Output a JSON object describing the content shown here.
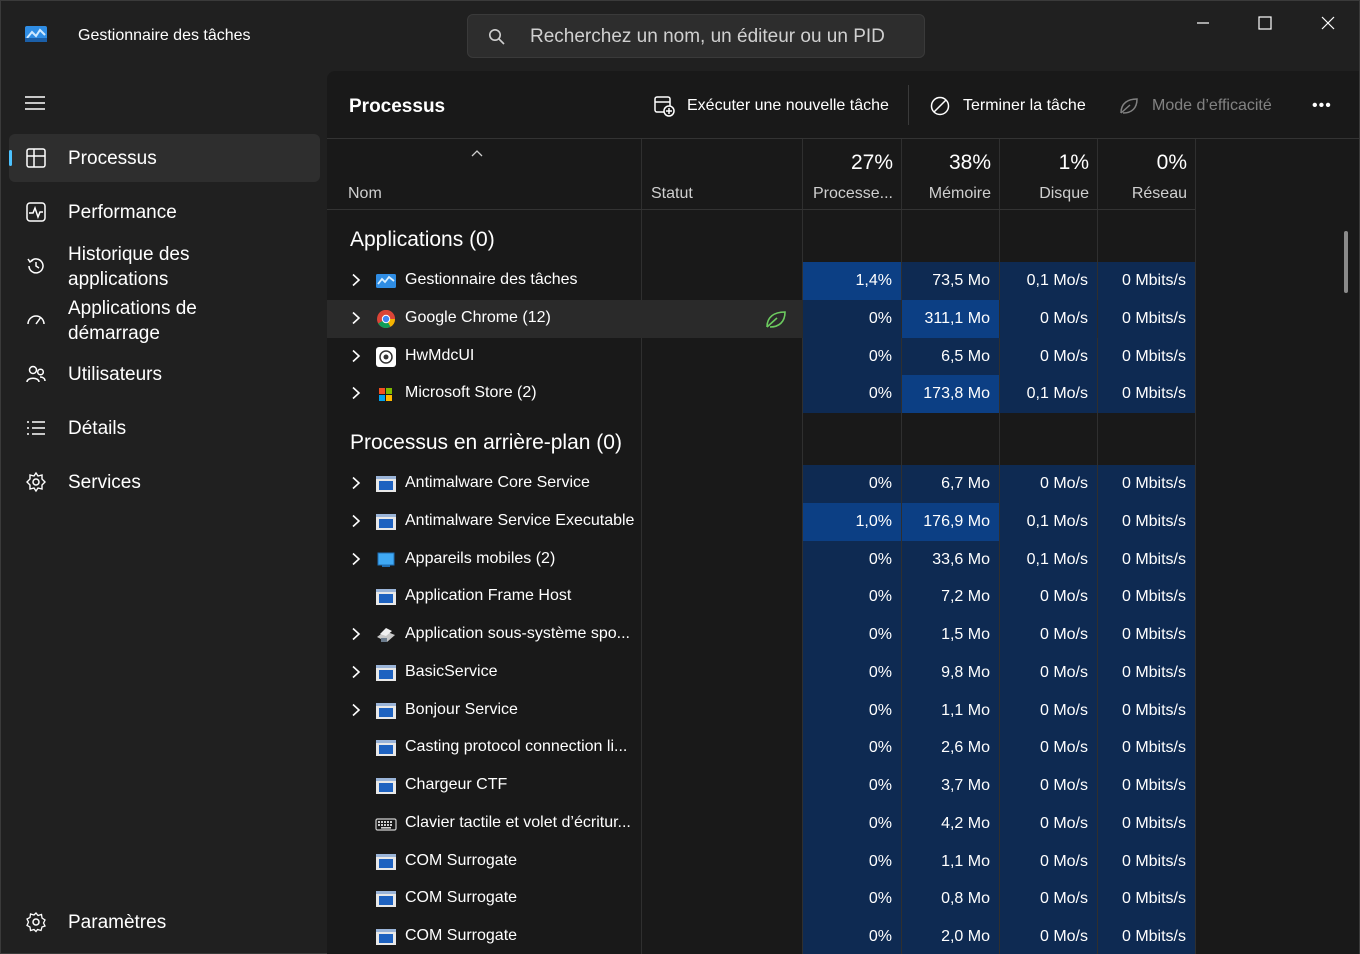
{
  "window": {
    "title": "Gestionnaire des tâches"
  },
  "search": {
    "placeholder": "Recherchez un nom, un éditeur ou un PID"
  },
  "colors": {
    "accent": "#4cc2ff",
    "heat_low": "#0e2a52",
    "heat_high": "#0c3f84",
    "efficiency_leaf": "#6ccb5f"
  },
  "sidebar": {
    "items": [
      {
        "label": "Processus",
        "icon": "processes-icon",
        "active": true
      },
      {
        "label": "Performance",
        "icon": "performance-icon"
      },
      {
        "label": "Historique des\napplications",
        "icon": "history-icon"
      },
      {
        "label": "Applications de\ndémarrage",
        "icon": "startup-icon"
      },
      {
        "label": "Utilisateurs",
        "icon": "users-icon"
      },
      {
        "label": "Détails",
        "icon": "details-icon"
      },
      {
        "label": "Services",
        "icon": "services-icon"
      }
    ],
    "settings_label": "Paramètres"
  },
  "toolbar": {
    "title": "Processus",
    "run_task_label": "Exécuter une nouvelle tâche",
    "end_task_label": "Terminer la tâche",
    "efficiency_label": "Mode d’efficacité",
    "more_label": "•••"
  },
  "columns": {
    "name": "Nom",
    "status": "Statut",
    "cpu": {
      "pct": "27%",
      "label": "Processe..."
    },
    "memory": {
      "pct": "38%",
      "label": "Mémoire"
    },
    "disk": {
      "pct": "1%",
      "label": "Disque"
    },
    "network": {
      "pct": "0%",
      "label": "Réseau"
    }
  },
  "sections": {
    "apps_title": "Applications (0)",
    "bg_title": "Processus en arrière-plan (0)"
  },
  "apps": [
    {
      "name": "Gestionnaire des tâches",
      "cpu": "1,4%",
      "mem": "73,5 Mo",
      "disk": "0,1 Mo/s",
      "net": "0 Mbits/s",
      "expandable": true,
      "icon": "taskmgr-icon"
    },
    {
      "name": "Google Chrome (12)",
      "cpu": "0%",
      "mem": "311,1 Mo",
      "disk": "0 Mo/s",
      "net": "0 Mbits/s",
      "expandable": true,
      "icon": "chrome-icon",
      "efficiency": true
    },
    {
      "name": "HwMdcUI",
      "cpu": "0%",
      "mem": "6,5 Mo",
      "disk": "0 Mo/s",
      "net": "0 Mbits/s",
      "expandable": true,
      "icon": "hwmdc-icon"
    },
    {
      "name": "Microsoft Store (2)",
      "cpu": "0%",
      "mem": "173,8 Mo",
      "disk": "0,1 Mo/s",
      "net": "0 Mbits/s",
      "expandable": true,
      "icon": "store-icon"
    }
  ],
  "background": [
    {
      "name": "Antimalware Core Service",
      "cpu": "0%",
      "mem": "6,7 Mo",
      "disk": "0 Mo/s",
      "net": "0 Mbits/s",
      "expandable": true,
      "icon": "service-window-icon"
    },
    {
      "name": "Antimalware Service Executable",
      "cpu": "1,0%",
      "mem": "176,9 Mo",
      "disk": "0,1 Mo/s",
      "net": "0 Mbits/s",
      "expandable": true,
      "icon": "service-window-icon"
    },
    {
      "name": "Appareils mobiles (2)",
      "cpu": "0%",
      "mem": "33,6 Mo",
      "disk": "0,1 Mo/s",
      "net": "0 Mbits/s",
      "expandable": true,
      "icon": "mobile-devices-icon"
    },
    {
      "name": "Application Frame Host",
      "cpu": "0%",
      "mem": "7,2 Mo",
      "disk": "0 Mo/s",
      "net": "0 Mbits/s",
      "expandable": false,
      "icon": "service-window-icon"
    },
    {
      "name": "Application sous-système spo...",
      "cpu": "0%",
      "mem": "1,5 Mo",
      "disk": "0 Mo/s",
      "net": "0 Mbits/s",
      "expandable": true,
      "icon": "printer-icon"
    },
    {
      "name": "BasicService",
      "cpu": "0%",
      "mem": "9,8 Mo",
      "disk": "0 Mo/s",
      "net": "0 Mbits/s",
      "expandable": true,
      "icon": "service-window-icon"
    },
    {
      "name": "Bonjour Service",
      "cpu": "0%",
      "mem": "1,1 Mo",
      "disk": "0 Mo/s",
      "net": "0 Mbits/s",
      "expandable": true,
      "icon": "service-window-icon"
    },
    {
      "name": "Casting protocol connection li...",
      "cpu": "0%",
      "mem": "2,6 Mo",
      "disk": "0 Mo/s",
      "net": "0 Mbits/s",
      "expandable": false,
      "icon": "service-window-icon"
    },
    {
      "name": "Chargeur CTF",
      "cpu": "0%",
      "mem": "3,7 Mo",
      "disk": "0 Mo/s",
      "net": "0 Mbits/s",
      "expandable": false,
      "icon": "service-window-icon"
    },
    {
      "name": "Clavier tactile et volet d’écritur...",
      "cpu": "0%",
      "mem": "4,2 Mo",
      "disk": "0 Mo/s",
      "net": "0 Mbits/s",
      "expandable": false,
      "icon": "keyboard-icon"
    },
    {
      "name": "COM Surrogate",
      "cpu": "0%",
      "mem": "1,1 Mo",
      "disk": "0 Mo/s",
      "net": "0 Mbits/s",
      "expandable": false,
      "icon": "service-window-icon"
    },
    {
      "name": "COM Surrogate",
      "cpu": "0%",
      "mem": "0,8 Mo",
      "disk": "0 Mo/s",
      "net": "0 Mbits/s",
      "expandable": false,
      "icon": "service-window-icon"
    },
    {
      "name": "COM Surrogate",
      "cpu": "0%",
      "mem": "2,0 Mo",
      "disk": "0 Mo/s",
      "net": "0 Mbits/s",
      "expandable": false,
      "icon": "service-window-icon"
    }
  ]
}
